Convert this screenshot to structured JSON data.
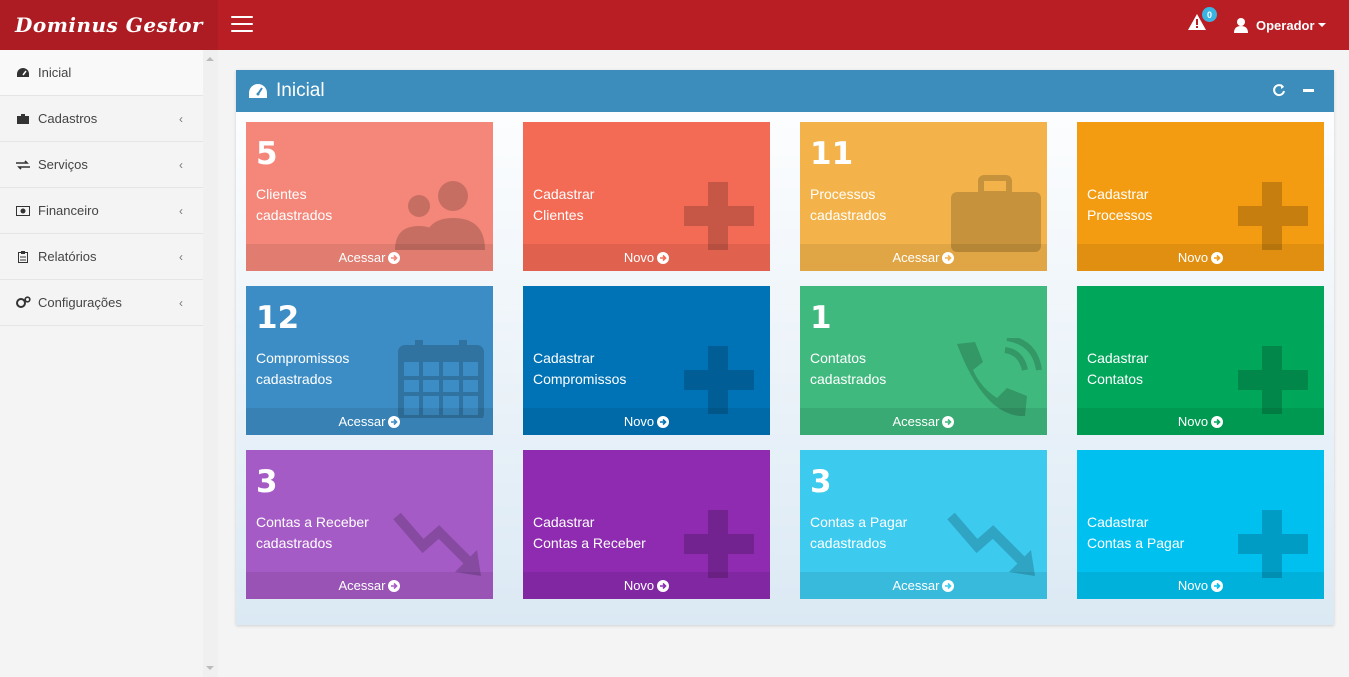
{
  "app": {
    "logo": "Dominus Gestor"
  },
  "header": {
    "alert_count": "0",
    "user_label": "Operador"
  },
  "sidebar": {
    "items": [
      {
        "label": "Inicial",
        "icon": "dashboard-icon"
      },
      {
        "label": "Cadastros",
        "icon": "briefcase-icon"
      },
      {
        "label": "Serviços",
        "icon": "exchange-icon"
      },
      {
        "label": "Financeiro",
        "icon": "money-icon"
      },
      {
        "label": "Relatórios",
        "icon": "clipboard-icon"
      },
      {
        "label": "Configurações",
        "icon": "cogs-icon"
      }
    ]
  },
  "panel": {
    "title": "Inicial"
  },
  "tiles": [
    {
      "number": "5",
      "line1": "Clientes",
      "line2": "cadastrados",
      "footer": "Acessar",
      "color": "#f4877a",
      "icon": "users-icon"
    },
    {
      "number": "",
      "line1": "Cadastrar",
      "line2": "Clientes",
      "footer": "Novo",
      "color": "#f36a55",
      "icon": "plus-icon"
    },
    {
      "number": "11",
      "line1": "Processos",
      "line2": "cadastrados",
      "footer": "Acessar",
      "color": "#f3b34a",
      "icon": "briefcase-icon"
    },
    {
      "number": "",
      "line1": "Cadastrar",
      "line2": "Processos",
      "footer": "Novo",
      "color": "#f39c12",
      "icon": "plus-icon"
    },
    {
      "number": "12",
      "line1": "Compromissos",
      "line2": "cadastrados",
      "footer": "Acessar",
      "color": "#3c8dc5",
      "icon": "calendar-icon"
    },
    {
      "number": "",
      "line1": "Cadastrar",
      "line2": "Compromissos",
      "footer": "Novo",
      "color": "#0073b7",
      "icon": "plus-icon"
    },
    {
      "number": "1",
      "line1": "Contatos",
      "line2": "cadastrados",
      "footer": "Acessar",
      "color": "#3fb97e",
      "icon": "phone-icon"
    },
    {
      "number": "",
      "line1": "Cadastrar",
      "line2": "Contatos",
      "footer": "Novo",
      "color": "#00a65a",
      "icon": "plus-icon"
    },
    {
      "number": "3",
      "line1": "Contas a Receber",
      "line2": "cadastrados",
      "footer": "Acessar",
      "color": "#a55bc5",
      "icon": "trend-down-icon"
    },
    {
      "number": "",
      "line1": "Cadastrar",
      "line2": "Contas a Receber",
      "footer": "Novo",
      "color": "#8e2bb0",
      "icon": "plus-icon"
    },
    {
      "number": "3",
      "line1": "Contas a Pagar",
      "line2": "cadastrados",
      "footer": "Acessar",
      "color": "#3ccaef",
      "icon": "trend-down-icon"
    },
    {
      "number": "",
      "line1": "Cadastrar",
      "line2": "Contas a Pagar",
      "footer": "Novo",
      "color": "#00c0ef",
      "icon": "plus-icon"
    }
  ]
}
